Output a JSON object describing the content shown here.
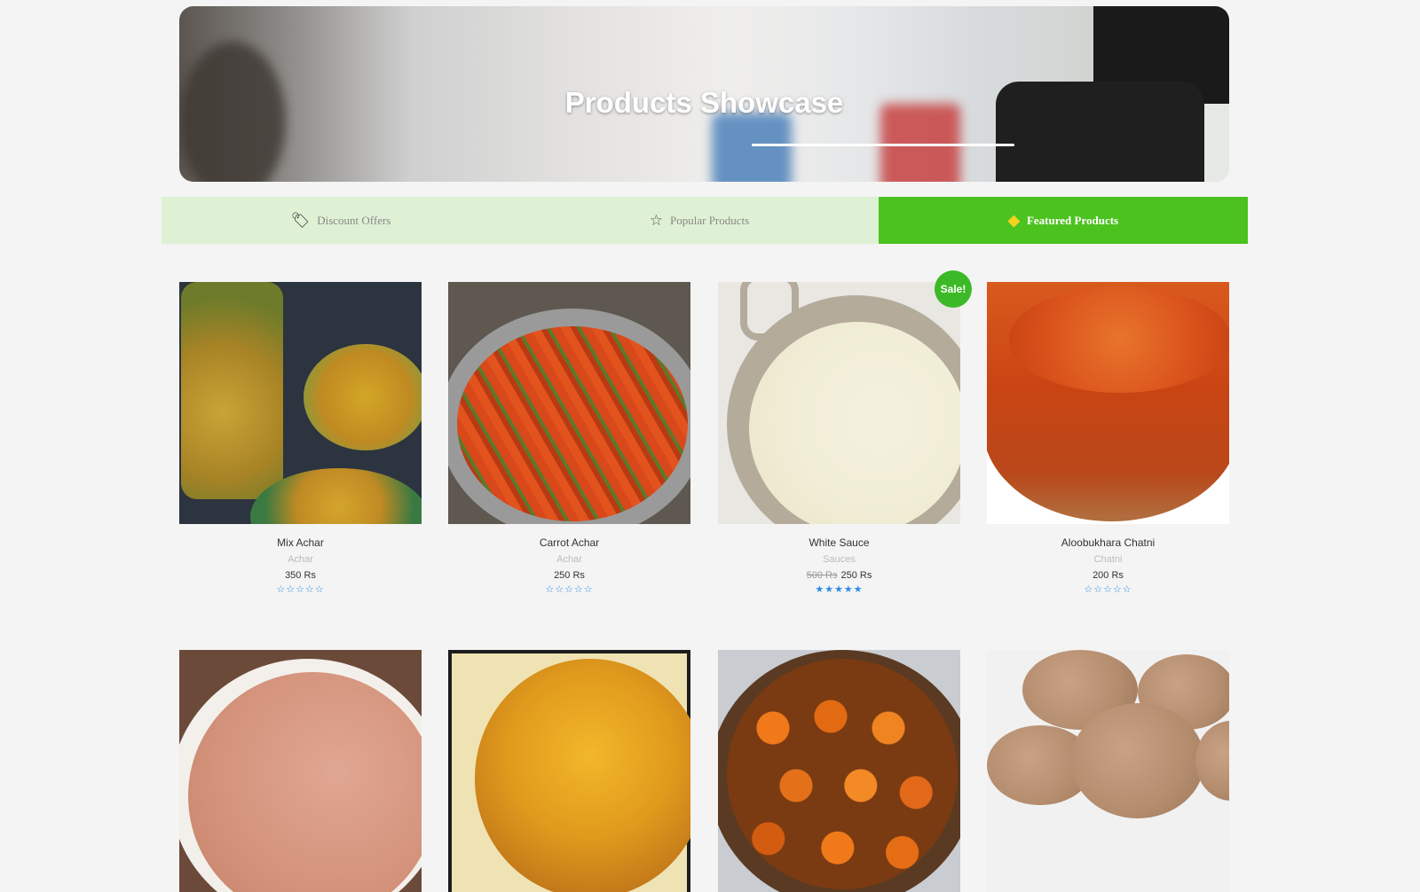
{
  "hero": {
    "title": "Products Showcase"
  },
  "tabs": [
    {
      "label": "Discount Offers",
      "icon": "tags-icon",
      "active": false
    },
    {
      "label": "Popular Products",
      "icon": "star-outline-icon",
      "active": false
    },
    {
      "label": "Featured Products",
      "icon": "diamond-icon",
      "active": true
    }
  ],
  "colors": {
    "accent": "#4cc21f",
    "tab_bar_bg": "#dff1d4",
    "sale_badge": "#3cb927",
    "rating": "#2f8be6"
  },
  "sale_badge": "Sale!",
  "products": [
    {
      "name": "Mix Achar",
      "category": "Achar",
      "old_price": "",
      "price": "350 Rs",
      "rating": 0,
      "image": "mix-achar"
    },
    {
      "name": "Carrot Achar",
      "category": "Achar",
      "old_price": "",
      "price": "250 Rs",
      "rating": 0,
      "image": "carrot-achar"
    },
    {
      "name": "White Sauce",
      "category": "Sauces",
      "old_price": "500 Rs",
      "price": "250 Rs",
      "rating": 5,
      "image": "white-sauce"
    },
    {
      "name": "Aloobukhara Chatni",
      "category": "Chatni",
      "old_price": "",
      "price": "200 Rs",
      "rating": 0,
      "image": "aloobukhara-chatni"
    },
    {
      "name": "",
      "category": "",
      "old_price": "",
      "price": "",
      "rating": 0,
      "image": "pink-dip"
    },
    {
      "name": "",
      "category": "",
      "old_price": "",
      "price": "",
      "rating": 0,
      "image": "mango-chutney"
    },
    {
      "name": "",
      "category": "",
      "old_price": "",
      "price": "",
      "rating": 0,
      "image": "gulab-jamun"
    },
    {
      "name": "",
      "category": "",
      "old_price": "",
      "price": "",
      "rating": 0,
      "image": "cookies"
    }
  ],
  "stars": {
    "filled": "★★★★★",
    "empty": "☆☆☆☆☆"
  }
}
